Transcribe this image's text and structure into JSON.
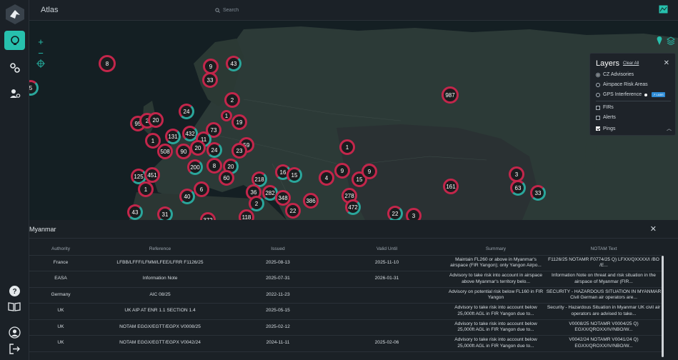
{
  "app": {
    "title": "Atlas"
  },
  "search": {
    "placeholder": "Search"
  },
  "colors": {
    "accent": "#27c0ad",
    "cluster_red": "#c3264b",
    "cluster_teal": "#2aa69b"
  },
  "sidebar": {
    "top_items": [
      {
        "icon": "lightbulb-icon",
        "active": true
      },
      {
        "icon": "gears-icon",
        "active": false
      },
      {
        "icon": "user-settings-icon",
        "active": false
      }
    ],
    "bottom_items": [
      {
        "icon": "help-icon"
      },
      {
        "icon": "book-icon"
      },
      {
        "icon": "account-icon"
      },
      {
        "icon": "logout-icon"
      }
    ]
  },
  "map": {
    "zoom_in": "+",
    "zoom_out": "−",
    "clusters": [
      "8",
      "9",
      "43",
      "5",
      "33",
      "2",
      "987",
      "24",
      "1",
      "19",
      "95",
      "2",
      "20",
      "73",
      "131",
      "432",
      "1",
      "11",
      "508",
      "90",
      "20",
      "24",
      "59",
      "23",
      "1",
      "200",
      "8",
      "20",
      "125",
      "451",
      "16",
      "15",
      "4",
      "9",
      "15",
      "9",
      "218",
      "60",
      "3",
      "63",
      "33",
      "1",
      "40",
      "6",
      "36",
      "282",
      "348",
      "161",
      "278",
      "2",
      "386",
      "472",
      "22",
      "43",
      "31",
      "372",
      "118",
      "22",
      "3"
    ]
  },
  "layers": {
    "title": "Layers",
    "clear_label": "Clear All",
    "items": [
      {
        "label": "CZ Advisories",
        "type": "radio",
        "on": true
      },
      {
        "label": "Airspace Risk Areas",
        "type": "radio",
        "on": false
      },
      {
        "label": "GPS Interference",
        "type": "radio",
        "on": false,
        "badge": "↗ LABS"
      },
      {
        "label": "FIRs",
        "type": "check",
        "on": false
      },
      {
        "label": "Alerts",
        "type": "check",
        "on": false
      },
      {
        "label": "Pings",
        "type": "check",
        "on": true
      }
    ]
  },
  "details": {
    "country": "Myanmar",
    "columns": [
      "Authority",
      "Reference",
      "Issued",
      "Valid Until",
      "Summary",
      "NOTAM Text"
    ],
    "rows": [
      {
        "authority": "France",
        "reference": "LFBB/LFFF/LFMM/LFEE/LFRR F1126/25",
        "issued": "2025-08-13",
        "valid_until": "2025-11-10",
        "summary": "Maintain FL260 or above in Myanmar's airspace (FIR Yangon); only Yangon Airpo...",
        "notam": "F1126/25 NOTAMR F0774/25 Q) LFXX/QXXXX/I /BO /E..."
      },
      {
        "authority": "EASA",
        "reference": "Information Note",
        "issued": "2025-07-31",
        "valid_until": "2026-01-31",
        "summary": "Advisory to take risk into account in airspace above Myanmar's territory belo...",
        "notam": "Information Note on threat and risk situation in the airspace of Myanmar (FIR..."
      },
      {
        "authority": "Germany",
        "reference": "AIC 08/25",
        "issued": "2022-11-23",
        "valid_until": "",
        "summary": "Advisory on potential risk below FL160 in FIR Yangon",
        "notam": "SECURITY - HAZARDOUS SITUATION IN MYANMAR Civil German air operators are..."
      },
      {
        "authority": "UK",
        "reference": "UK AIP AT ENR 1.1 SECTION 1.4",
        "issued": "2025-05-15",
        "valid_until": "",
        "summary": "Advisory to take risk into account below 25,000ft AGL in FIR Yangon due to...",
        "notam": "Security - Hazardous Situation in Myanmar UK civil air operators are advised to take..."
      },
      {
        "authority": "UK",
        "reference": "NOTAM EGGX/EGTT/EGPX V0008/25",
        "issued": "2025-02-12",
        "valid_until": "",
        "summary": "Advisory to take risk into account below 25,000ft AGL in FIR Yangon due to...",
        "notam": "V0008/25 NOTAMR V0004/25 Q) EGXX/QROXX/IV/NBO/W..."
      },
      {
        "authority": "UK",
        "reference": "NOTAM EGGX/EGTT/EGPX V0042/24",
        "issued": "2024-11-11",
        "valid_until": "2025-02-06",
        "summary": "Advisory to take risk into account below 25,000ft AGL in FIR Yangon due to...",
        "notam": "V0042/24 NOTAMR V0041/24 Q) EGXX/QROXX/IV/NBO/W..."
      }
    ]
  }
}
